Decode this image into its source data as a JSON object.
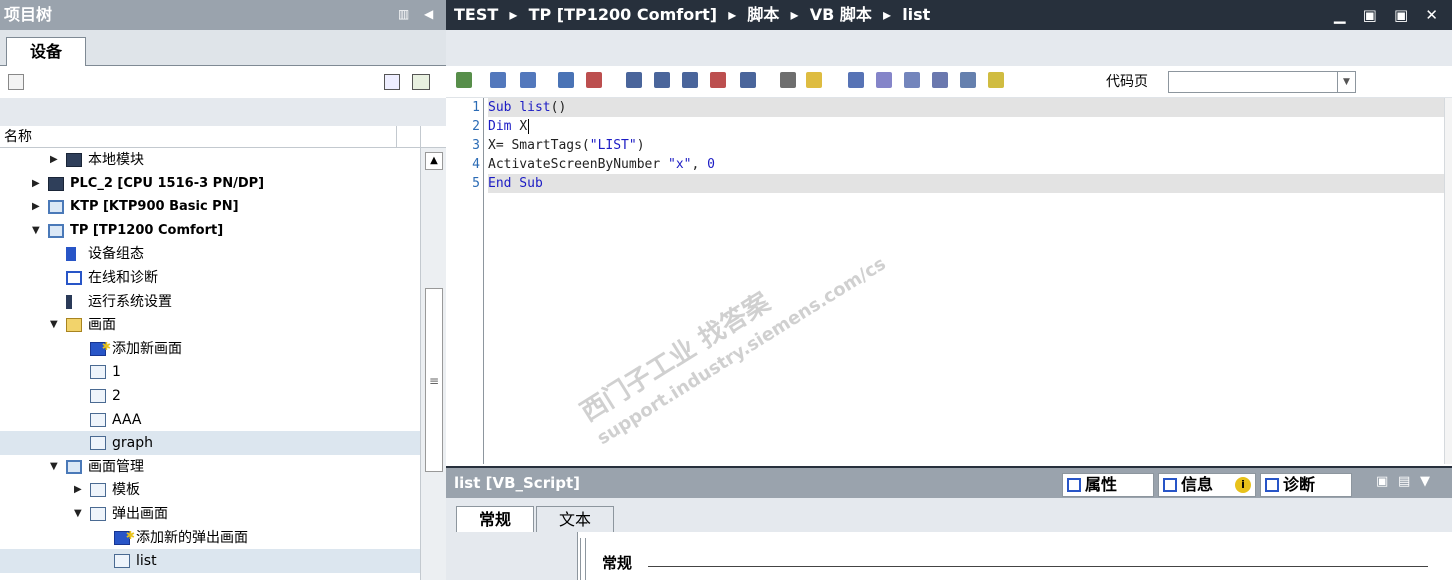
{
  "left_panel": {
    "title": "项目树",
    "tab": "设备",
    "column_header": "名称",
    "tree": [
      {
        "label": "本地模块",
        "level": 2,
        "expanded": false,
        "icon": "plc-icon"
      },
      {
        "label": "PLC_2 [CPU 1516-3 PN/DP]",
        "level": 1,
        "expanded": false,
        "icon": "plc-icon"
      },
      {
        "label": "KTP [KTP900 Basic PN]",
        "level": 1,
        "expanded": false,
        "icon": "hmi-icon"
      },
      {
        "label": "TP [TP1200 Comfort]",
        "level": 1,
        "expanded": true,
        "icon": "hmi-icon"
      },
      {
        "label": "设备组态",
        "level": 2,
        "icon": "device-config-icon"
      },
      {
        "label": "在线和诊断",
        "level": 2,
        "icon": "online-diagnostics-icon"
      },
      {
        "label": "运行系统设置",
        "level": 2,
        "icon": "runtime-settings-icon"
      },
      {
        "label": "画面",
        "level": 2,
        "expanded": true,
        "icon": "folder-icon"
      },
      {
        "label": "添加新画面",
        "level": 3,
        "icon": "add-screen-icon"
      },
      {
        "label": "1",
        "level": 3,
        "icon": "screen-icon"
      },
      {
        "label": "2",
        "level": 3,
        "icon": "screen-icon"
      },
      {
        "label": "AAA",
        "level": 3,
        "icon": "screen-icon"
      },
      {
        "label": "graph",
        "level": 3,
        "icon": "screen-icon"
      },
      {
        "label": "画面管理",
        "level": 2,
        "expanded": true,
        "icon": "screen-management-icon"
      },
      {
        "label": "模板",
        "level": 3,
        "expanded": false,
        "icon": "template-icon"
      },
      {
        "label": "弹出画面",
        "level": 3,
        "expanded": true,
        "icon": "popup-folder-icon"
      },
      {
        "label": "添加新的弹出画面",
        "level": 4,
        "icon": "add-popup-icon"
      },
      {
        "label": "list",
        "level": 4,
        "icon": "screen-icon",
        "selected": true
      }
    ]
  },
  "editor": {
    "breadcrumb": [
      "TEST",
      "TP [TP1200 Comfort]",
      "脚本",
      "VB 脚本",
      "list"
    ],
    "breadcrumb_sep": "▸",
    "codepage_label": "代码页",
    "codepage_value": "",
    "window_controls": "▁ ▣ ▣ ✕",
    "lines": [
      {
        "no": "1",
        "parts": [
          {
            "t": "Sub ",
            "c": "kw"
          },
          {
            "t": "list",
            "c": "fn-blue"
          },
          {
            "t": "()",
            "c": "fn"
          }
        ]
      },
      {
        "no": "2",
        "parts": [
          {
            "t": "Dim ",
            "c": "kw"
          },
          {
            "t": "X",
            "c": "fn"
          }
        ]
      },
      {
        "no": "3",
        "parts": [
          {
            "t": "X= SmartTags(",
            "c": "fn"
          },
          {
            "t": "\"LIST\"",
            "c": "str"
          },
          {
            "t": ")",
            "c": "fn"
          }
        ]
      },
      {
        "no": "4",
        "parts": [
          {
            "t": "ActivateScreenByNumber ",
            "c": "fn"
          },
          {
            "t": "\"x\"",
            "c": "str"
          },
          {
            "t": ", ",
            "c": "fn"
          },
          {
            "t": "0",
            "c": "num"
          }
        ]
      },
      {
        "no": "5",
        "parts": [
          {
            "t": "End Sub",
            "c": "kw"
          }
        ]
      }
    ],
    "watermark": [
      "西门子工业 找答案",
      "support.industry.siemens.com/cs"
    ]
  },
  "bottom_panel": {
    "title": "list [VB_Script]",
    "tab_properties": "属性",
    "tab_info": "信息",
    "tab_diagnostics": "诊断",
    "subtab_general": "常规",
    "subtab_text": "文本",
    "section_general": "常规"
  }
}
